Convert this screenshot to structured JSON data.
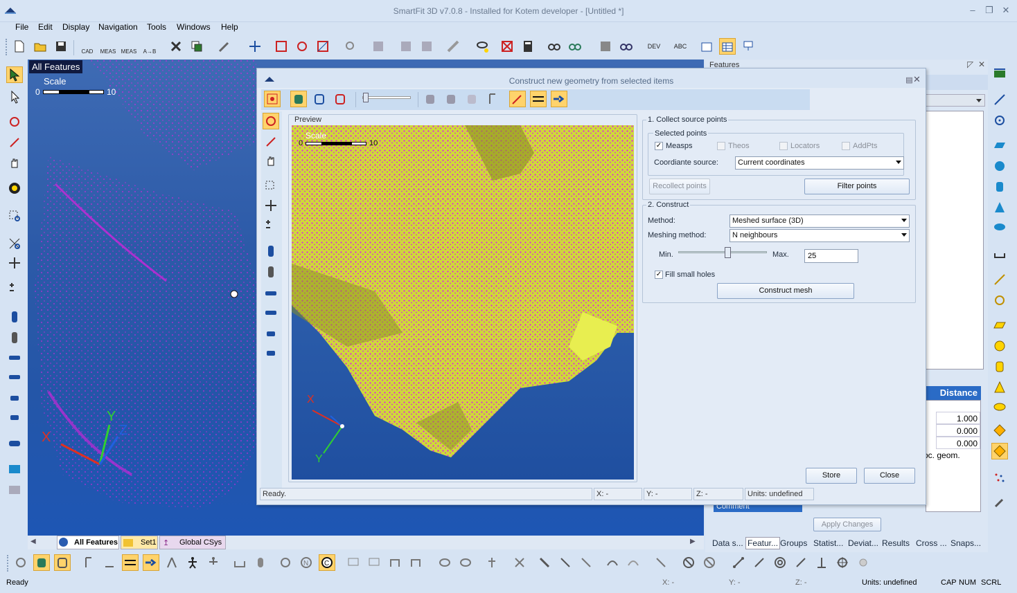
{
  "window": {
    "title": "SmartFit 3D v7.0.8 - Installed for Kotem developer - [Untitled *]"
  },
  "menu": [
    "File",
    "Edit",
    "Display",
    "Navigation",
    "Tools",
    "Windows",
    "Help"
  ],
  "toolbar": {
    "cad": "CAD",
    "meas1": "MEAS",
    "meas2": "MEAS",
    "atob": "A→B",
    "dev": "DEV",
    "abc": "ABC"
  },
  "view3d": {
    "title": "All Features",
    "scale_label": "Scale",
    "scale_min": "0",
    "scale_max": "10",
    "axis_x": "X",
    "axis_y": "Y",
    "axis_z": "Z"
  },
  "dialog": {
    "title": "Construct new geometry from selected items",
    "preview_label": "Preview",
    "preview_scale": "Scale",
    "preview_min": "0",
    "preview_max": "10",
    "section1": "1. Collect source points",
    "selected_points": "Selected points",
    "measps": "Measps",
    "theos": "Theos",
    "locators": "Locators",
    "addpts": "AddPts",
    "coord_label": "Coordiante source:",
    "coord_value": "Current coordinates",
    "recollect": "Recollect points",
    "filter": "Filter points",
    "section2": "2. Construct",
    "method_label": "Method:",
    "method_value": "Meshed surface (3D)",
    "meshing_label": "Meshing method:",
    "meshing_value": "N neighbours",
    "min_label": "Min.",
    "max_label": "Max.",
    "max_value": "25",
    "fill_holes": "Fill small holes",
    "construct": "Construct mesh",
    "store": "Store",
    "close": "Close",
    "status": "Ready.",
    "x": "X: -",
    "y": "Y: -",
    "z": "Z: -",
    "units": "Units: undefined"
  },
  "features_panel": {
    "title": "Features",
    "distance_header": "Distance",
    "values": [
      "1.000",
      "0.000",
      "0.000"
    ],
    "geom_text": "oc. geom.",
    "comment": "Comment",
    "apply": "Apply Changes",
    "tabs": [
      "Data s...",
      "Featur...",
      "Groups",
      "Statist...",
      "Deviat...",
      "Results",
      "Cross ...",
      "Snaps..."
    ]
  },
  "bottom_tabs": [
    "All Features",
    "Set1",
    "Global CSys"
  ],
  "statusbar": {
    "ready": "Ready",
    "x": "X: -",
    "y": "Y: -",
    "z": "Z: -",
    "units": "Units: undefined",
    "cap": "CAP",
    "num": "NUM",
    "scrl": "SCRL"
  },
  "colors": {
    "accent": "#ffd36b",
    "points": "#e020e0",
    "mesh": "#d9e030",
    "background3d": "#2c5aa8"
  }
}
